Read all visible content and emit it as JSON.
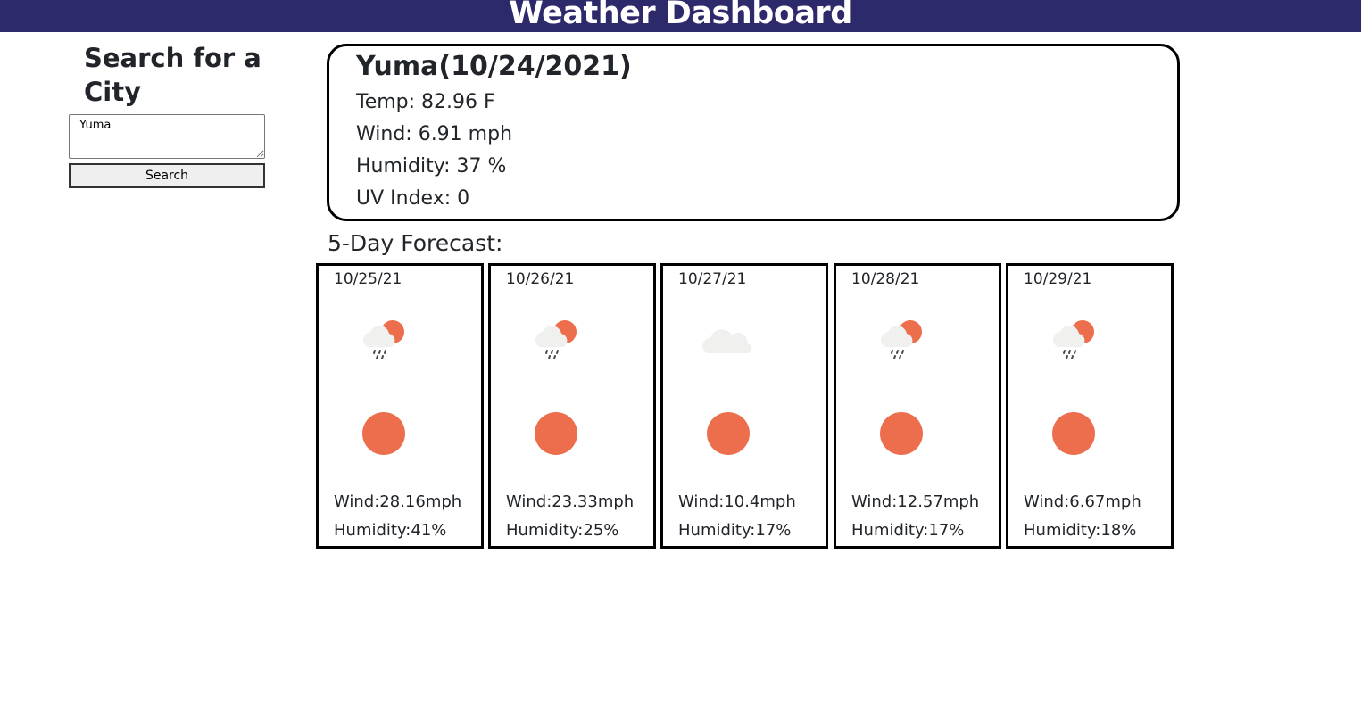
{
  "header": {
    "title": "Weather Dashboard",
    "background_color": "#2d2a6b"
  },
  "search": {
    "title": "Search for a City",
    "input_value": "Yuma",
    "button_label": "Search"
  },
  "current": {
    "city_date": "Yuma(10/24/2021)",
    "temp": "Temp: 82.96 F",
    "wind": "Wind: 6.91 mph",
    "humidity": "Humidity: 37 %",
    "uv": "UV Index: 0"
  },
  "forecast": {
    "title": "5-Day Forecast:",
    "days": [
      {
        "date": "10/25/21",
        "icon": "rain-sun-icon",
        "sun_icon": "sun-icon",
        "wind": "Wind:28.16mph",
        "humidity": "Humidity:41%"
      },
      {
        "date": "10/26/21",
        "icon": "rain-sun-icon",
        "sun_icon": "sun-icon",
        "wind": "Wind:23.33mph",
        "humidity": "Humidity:25%"
      },
      {
        "date": "10/27/21",
        "icon": "cloud-icon",
        "sun_icon": "sun-icon",
        "wind": "Wind:10.4mph",
        "humidity": "Humidity:17%"
      },
      {
        "date": "10/28/21",
        "icon": "rain-sun-icon",
        "sun_icon": "sun-icon",
        "wind": "Wind:12.57mph",
        "humidity": "Humidity:17%"
      },
      {
        "date": "10/29/21",
        "icon": "rain-sun-icon",
        "sun_icon": "sun-icon",
        "wind": "Wind:6.67mph",
        "humidity": "Humidity:18%"
      }
    ]
  },
  "colors": {
    "sun": "#ec6e4c",
    "cloud": "#f0f0ef",
    "rain": "#4a4a4a"
  }
}
